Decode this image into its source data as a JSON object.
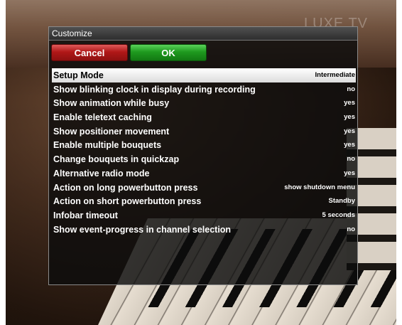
{
  "watermark": "LUXE TV",
  "dialog": {
    "title": "Customize",
    "buttons": {
      "cancel_label": "Cancel",
      "ok_label": "OK"
    },
    "settings": [
      {
        "label": "Setup Mode",
        "value": "Intermediate",
        "selected": true
      },
      {
        "label": "Show blinking clock in display during recording",
        "value": "no"
      },
      {
        "label": "Show animation while busy",
        "value": "yes"
      },
      {
        "label": "Enable teletext caching",
        "value": "yes"
      },
      {
        "label": "Show positioner movement",
        "value": "yes"
      },
      {
        "label": "Enable multiple bouquets",
        "value": "yes"
      },
      {
        "label": "Change bouquets in quickzap",
        "value": "no"
      },
      {
        "label": "Alternative radio mode",
        "value": "yes"
      },
      {
        "label": "Action on long powerbutton press",
        "value": "show shutdown menu"
      },
      {
        "label": "Action on short powerbutton press",
        "value": "Standby"
      },
      {
        "label": "Infobar timeout",
        "value": "5 seconds"
      },
      {
        "label": "Show event-progress in channel selection",
        "value": "no"
      }
    ]
  }
}
